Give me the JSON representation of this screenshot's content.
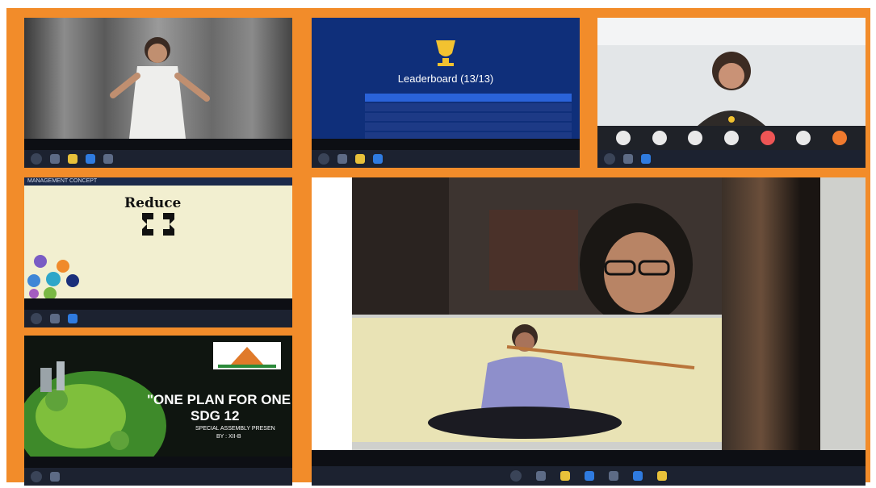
{
  "tiles": {
    "leaderboard": {
      "title": "Leaderboard (13/13)"
    },
    "concept": {
      "header": "MANAGEMENT CONCEPT",
      "word": "Reduce"
    },
    "assembly": {
      "line1": "\"ONE PLAN FOR ONE",
      "line2": "SDG 12",
      "line3": "SPECIAL ASSEMBLY PRESEN",
      "line4": "BY : XII-B"
    }
  },
  "colors": {
    "frame": "#f28c2a",
    "leaderboard_bg": "#0f2f7a",
    "taskbar": "#1c2230",
    "slide_bg": "#f2efd0"
  }
}
